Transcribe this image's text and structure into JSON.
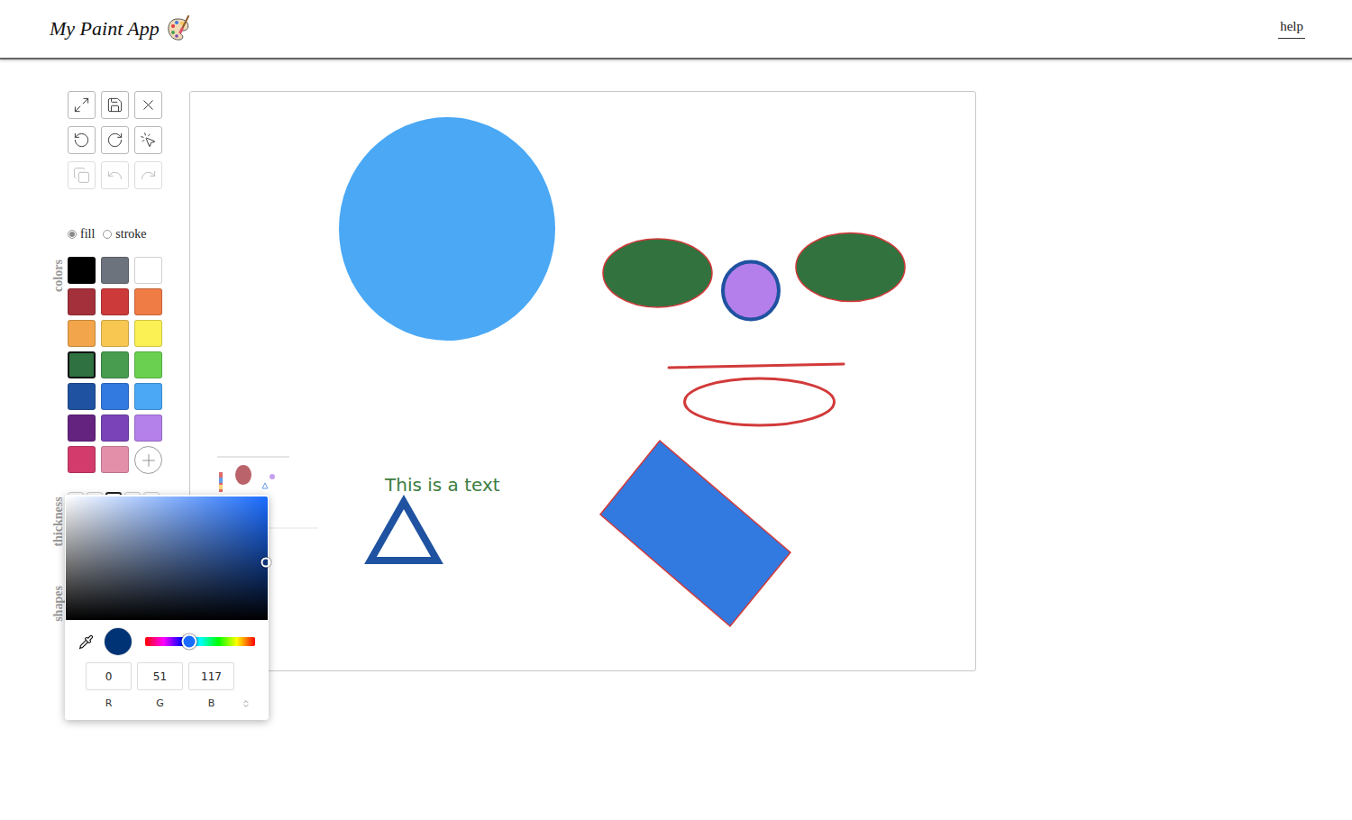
{
  "header": {
    "title": "My Paint App",
    "help": "help"
  },
  "tools": [
    {
      "disabled": false
    },
    {
      "disabled": false
    },
    {
      "disabled": false
    },
    {
      "disabled": false
    },
    {
      "disabled": false
    },
    {
      "disabled": false
    },
    {
      "disabled": true
    },
    {
      "disabled": true
    },
    {
      "disabled": true
    }
  ],
  "paint_mode": [
    {
      "label": "fill",
      "selected": true
    },
    {
      "label": "stroke",
      "selected": false
    }
  ],
  "sections": {
    "colors": "colors",
    "thickness": "thickness",
    "shapes": "shapes"
  },
  "palette": [
    {
      "color": "#000000",
      "selected": false
    },
    {
      "color": "#6c737d",
      "selected": false
    },
    {
      "color": "#ffffff",
      "selected": false
    },
    {
      "color": "#a3303a",
      "selected": false
    },
    {
      "color": "#cc3a3a",
      "selected": false
    },
    {
      "color": "#ef7b45",
      "selected": false
    },
    {
      "color": "#f2a54a",
      "selected": false
    },
    {
      "color": "#f7c752",
      "selected": false
    },
    {
      "color": "#fbf154",
      "selected": false
    },
    {
      "color": "#2f7140",
      "selected": true
    },
    {
      "color": "#479c4f",
      "selected": false
    },
    {
      "color": "#6ad150",
      "selected": false
    },
    {
      "color": "#1f52a0",
      "selected": false
    },
    {
      "color": "#3279e0",
      "selected": false
    },
    {
      "color": "#4aa8f5",
      "selected": false
    },
    {
      "color": "#652380",
      "selected": false
    },
    {
      "color": "#7a44b8",
      "selected": false
    },
    {
      "color": "#b480ea",
      "selected": false
    },
    {
      "color": "#d23b6c",
      "selected": false
    },
    {
      "color": "#e38fa9",
      "selected": false
    }
  ],
  "thickness": [
    {
      "selected": false
    },
    {
      "selected": false
    },
    {
      "selected": true
    },
    {
      "selected": false
    },
    {
      "selected": false
    }
  ],
  "canvas": {
    "text": {
      "content": "This is a text",
      "color": "#3b7d3f"
    },
    "shapes": [
      {
        "kind": "circle",
        "fill": "#4aa8f5",
        "outline": "none"
      },
      {
        "kind": "ellipse",
        "fill": "#31723f",
        "outline": "#d23a3a"
      },
      {
        "kind": "circle",
        "fill": "#b47fea",
        "outline": "#1f52a0"
      },
      {
        "kind": "ellipse",
        "fill": "#31723f",
        "outline": "#d23a3a"
      },
      {
        "kind": "line",
        "fill": "none",
        "outline": "#d23a3a"
      },
      {
        "kind": "ellipse",
        "fill": "none",
        "outline": "#d23a3a"
      },
      {
        "kind": "triangle",
        "fill": "none",
        "outline": "#1f52a0"
      },
      {
        "kind": "rectangle",
        "fill": "#3279e0",
        "outline": "#d23a3a"
      }
    ]
  },
  "color_picker": {
    "color": "#003375",
    "hue_color": "#1a6cff",
    "hue_level": 0.4,
    "saturation_level": 0.99,
    "brightness_level": 0.47,
    "channels": [
      {
        "label": "R",
        "value": "0"
      },
      {
        "label": "G",
        "value": "51"
      },
      {
        "label": "B",
        "value": "117"
      }
    ]
  }
}
